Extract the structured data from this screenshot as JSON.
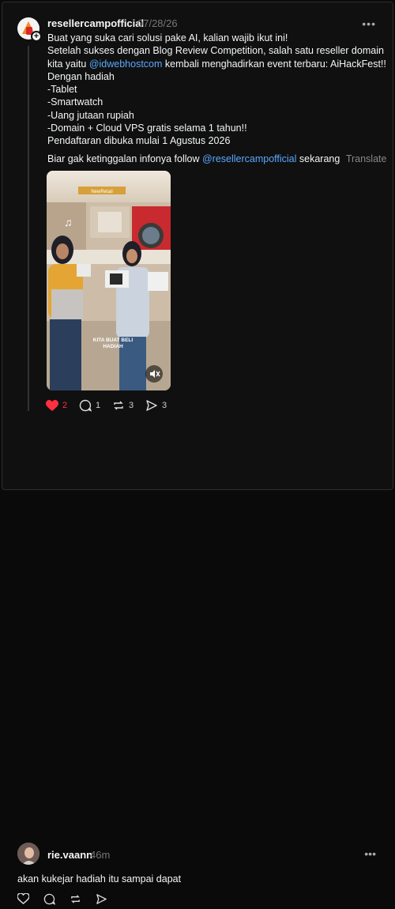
{
  "post": {
    "username": "resellercampofficial",
    "timestamp": "07/28/26",
    "lines": [
      "Buat yang suka cari solusi pake AI, kalian wajib ikut ini!",
      "Setelah sukses dengan Blog Review Competition, salah satu reseller domain",
      "kita yaitu ",
      "Dengan hadiah",
      "-Tablet",
      "-Smartwatch",
      "-Uang jutaan rupiah",
      "-Domain + Cloud VPS gratis selama 1 tahun!!",
      "Pendaftaran dibuka mulai 1 Agustus 2026"
    ],
    "mention_in_body": "@idwebhostcom",
    "line3_after_mention": " kembali menghadirkan event terbaru: AiHackFest!!",
    "follow_prefix": "Biar gak ketinggalan infonya follow ",
    "follow_mention": "@resellercampofficial",
    "follow_suffix": " sekarang",
    "translate": "Translate",
    "photo": {
      "caption_line1": "KITA BUAT BELI",
      "caption_line2": "HADIAH",
      "store_sign": "NewRetail"
    },
    "likes": "2",
    "replies": "1",
    "reposts": "3",
    "shares": "3"
  },
  "reply": {
    "username": "rie.vaann",
    "timestamp": "46m",
    "text": "akan kukejar hadiah itu sampai dapat"
  },
  "colors": {
    "background": "#101010",
    "text": "#f3f5f7",
    "muted": "#777777",
    "link": "#5aa8ff",
    "like": "#ff3040"
  }
}
